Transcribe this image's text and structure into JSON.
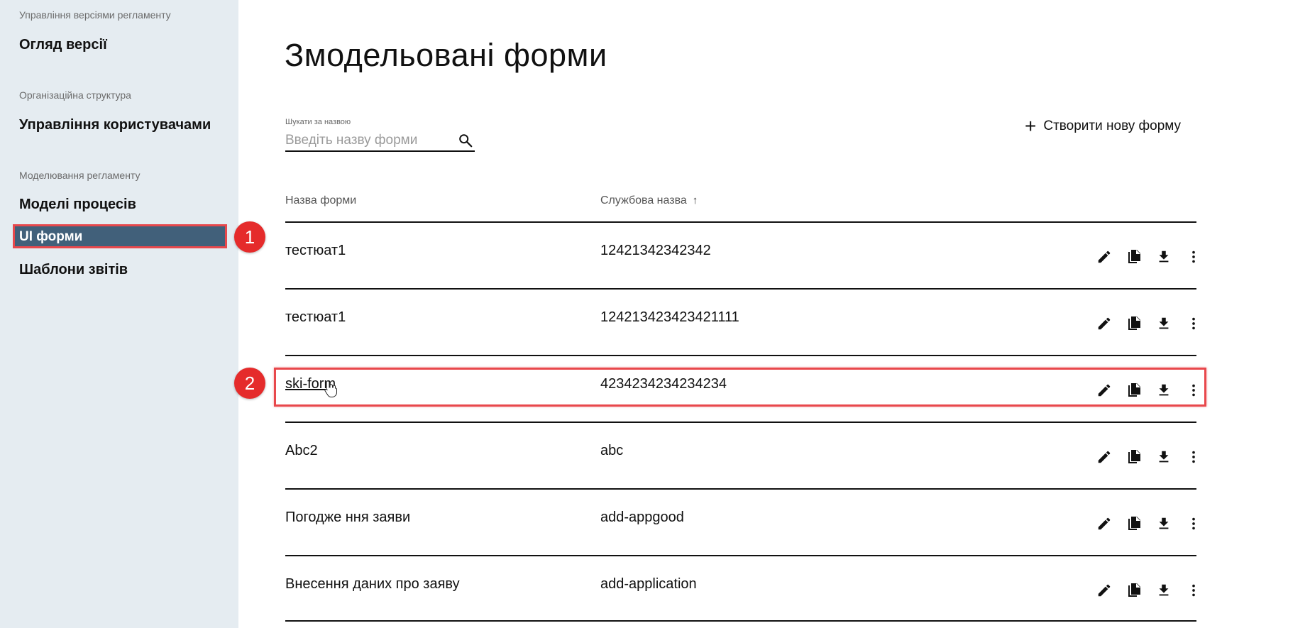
{
  "sidebar": {
    "sections": [
      {
        "label": "Управління версіями регламенту",
        "items": [
          "Огляд версії"
        ]
      },
      {
        "label": "Організаційна структура",
        "items": [
          "Управління користувачами"
        ]
      },
      {
        "label": "Моделювання регламенту",
        "items": [
          "Моделі процесів",
          "UI форми",
          "Шаблони звітів"
        ]
      }
    ],
    "active_item": "UI форми"
  },
  "page": {
    "title": "Змодельовані форми"
  },
  "search": {
    "label": "Шукати за назвою",
    "placeholder": "Введіть назву форми",
    "value": ""
  },
  "create_button": {
    "label": "Створити нову форму",
    "icon": "plus-icon"
  },
  "table": {
    "columns": [
      {
        "label": "Назва форми",
        "sort": ""
      },
      {
        "label": "Службова назва",
        "sort": "↑"
      }
    ],
    "rows": [
      {
        "name": "тестюат1",
        "service": "12421342342342"
      },
      {
        "name": "тестюат1",
        "service": "124213423423421111"
      },
      {
        "name": "ski-form",
        "service": "4234234234234234"
      },
      {
        "name": "Abc2",
        "service": "abc"
      },
      {
        "name": "Погодже ння заяви",
        "service": "add-appgood"
      },
      {
        "name": "Внесення даних про заяву",
        "service": "add-application"
      }
    ],
    "row_actions": [
      "pencil-icon",
      "copy-icon",
      "download-icon",
      "more-vertical-icon"
    ]
  },
  "annotations": {
    "badge_1": "1",
    "badge_2": "2"
  },
  "colors": {
    "sidebar_bg": "#e5ecf1",
    "active_item_bg": "#41607a",
    "highlight": "#e8484c",
    "badge": "#e52b2b"
  }
}
